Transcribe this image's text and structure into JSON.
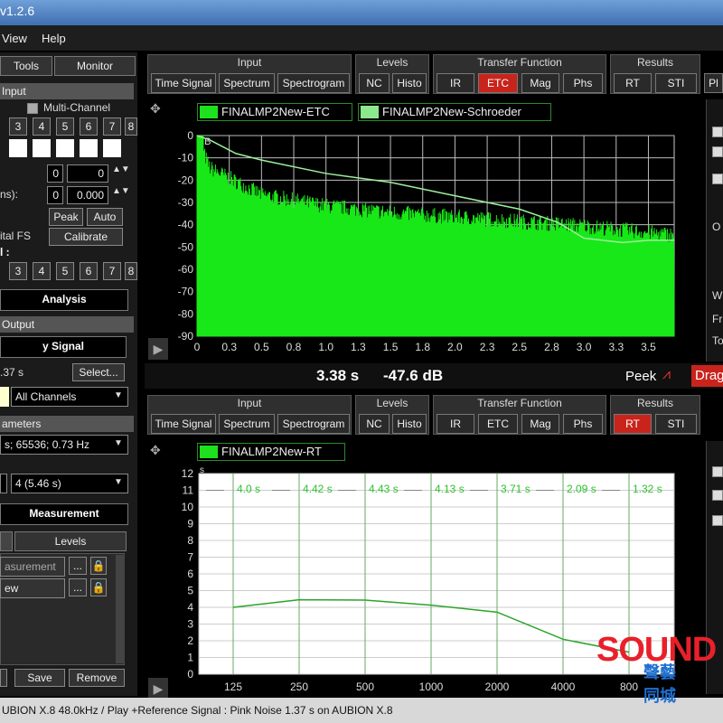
{
  "window": {
    "title": "v1.2.6"
  },
  "menu": [
    "View",
    "Help"
  ],
  "left": {
    "tabs": [
      "Tools",
      "Monitor"
    ],
    "input_header": "Input",
    "multichannel_label": "Multi-Channel",
    "channel_numbers_top": [
      "3",
      "4",
      "5",
      "6",
      "7",
      "8"
    ],
    "field1_value": "0",
    "field1_value2": "0",
    "ms_label": "ns):",
    "field2_value": "0",
    "field2_value2": "0.000",
    "peak_btn": "Peak",
    "auto_btn": "Auto",
    "digital_fs": "ital FS",
    "calibrate_btn": "Calibrate",
    "l_label": "l :",
    "channel_numbers_bottom": [
      "3",
      "4",
      "5",
      "6",
      "7",
      "8"
    ],
    "analysis_btn": "Analysis",
    "output_header": "Output",
    "signal_btn": "y Signal",
    "duration": ".37 s",
    "select_btn": "Select...",
    "channels_select": "All Channels",
    "params_header": "ameters",
    "fft_select": "s; 65536; 0.73 Hz",
    "avg_select": "4 (5.46 s)",
    "measurement_btn": "Measurement",
    "tab_levels": "Levels",
    "list_item1": "asurement",
    "list_item2": "ew",
    "save_btn": "Save",
    "remove_btn": "Remove"
  },
  "groups": {
    "input": "Input",
    "levels": "Levels",
    "transfer": "Transfer Function",
    "results": "Results",
    "time_signal": "Time Signal",
    "spectrum": "Spectrum",
    "spectrogram": "Spectrogram",
    "nc": "NC",
    "histo": "Histo",
    "ir": "IR",
    "etc": "ETC",
    "mag": "Mag",
    "phs": "Phs",
    "rt": "RT",
    "sti": "STI",
    "pl": "Pl"
  },
  "top_chart": {
    "legend": [
      "FINALMP2New-ETC",
      "FINALMP2New-Schroeder"
    ],
    "unit": "dB",
    "y_ticks": [
      "0",
      "-10",
      "-20",
      "-30",
      "-40",
      "-50",
      "-60",
      "-70",
      "-80",
      "-90"
    ],
    "x_ticks": [
      "0",
      "0.3",
      "0.5",
      "0.8",
      "1.0",
      "1.3",
      "1.5",
      "1.8",
      "2.0",
      "2.3",
      "2.5",
      "2.8",
      "3.0",
      "3.3",
      "3.5"
    ],
    "readout_time": "3.38 s",
    "readout_db": "-47.6 dB",
    "peek_label": "Peek",
    "drag_label": "Drag",
    "right_labels": [
      "O",
      "W",
      "Fr",
      "To"
    ]
  },
  "bottom_chart": {
    "legend": "FINALMP2New-RT",
    "unit": "s",
    "y_ticks": [
      "12",
      "11",
      "10",
      "9",
      "8",
      "7",
      "6",
      "5",
      "4",
      "3",
      "2",
      "1",
      "0"
    ],
    "x_ticks": [
      "125",
      "250",
      "500",
      "1000",
      "2000",
      "4000",
      "800"
    ],
    "band_labels": [
      "4.0 s",
      "4.42 s",
      "4.43 s",
      "4.13 s",
      "3.71 s",
      "2.09 s",
      "1.32 s"
    ]
  },
  "status_bar": "UBION X.8 48.0kHz / Play +Reference Signal : Pink Noise  1.37 s on AUBION X.8",
  "watermark": {
    "text": "SOUND",
    "sub1": "聲藝",
    "sub2": "同城"
  },
  "chart_data": [
    {
      "type": "line",
      "title": "",
      "xlabel": "",
      "ylabel": "dB",
      "xlim": [
        0,
        3.7
      ],
      "ylim": [
        -90,
        0
      ],
      "series": [
        {
          "name": "FINALMP2New-ETC",
          "x": [
            0,
            0.1,
            0.5,
            1.0,
            1.5,
            2.0,
            2.5,
            3.0,
            3.5,
            3.7
          ],
          "y": [
            -4,
            -18,
            -30,
            -35,
            -38,
            -40,
            -42,
            -44,
            -47,
            -48
          ]
        },
        {
          "name": "FINALMP2New-Schroeder",
          "x": [
            0,
            0.1,
            0.3,
            0.5,
            1.0,
            1.5,
            2.0,
            2.5,
            2.8,
            3.0,
            3.3,
            3.5,
            3.7
          ],
          "y": [
            0,
            -2,
            -8,
            -11,
            -17,
            -21,
            -27,
            -33,
            -39,
            -46,
            -48,
            -47,
            -47
          ]
        }
      ]
    },
    {
      "type": "line",
      "title": "",
      "ylabel": "s",
      "categories": [
        "125",
        "250",
        "500",
        "1000",
        "2000",
        "4000",
        "8000"
      ],
      "ylim": [
        0,
        12
      ],
      "series": [
        {
          "name": "FINALMP2New-RT",
          "values": [
            4.0,
            4.42,
            4.43,
            4.13,
            3.71,
            2.09,
            1.32
          ]
        }
      ]
    }
  ]
}
